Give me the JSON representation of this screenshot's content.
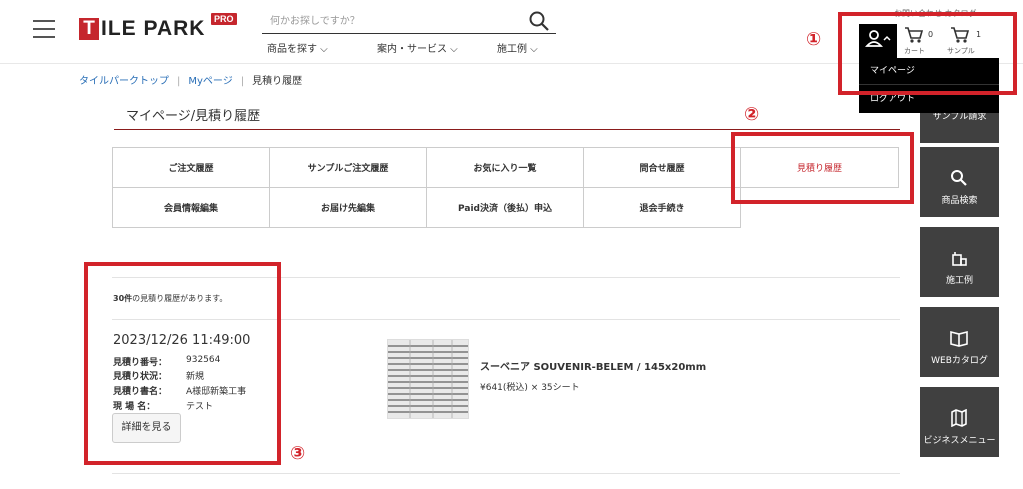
{
  "header": {
    "logo_first_letter": "T",
    "logo_rest": "ILE PARK",
    "pro_badge": "PRO",
    "search_placeholder": "何かお探しですか？",
    "nav": [
      "商品を探す ⌵",
      "案内・サービス ⌵",
      "施工例 ⌵"
    ],
    "top_link": "お問い合わせ カタログ",
    "cart_count": "0",
    "cart_label": "カート",
    "sample_count": "1",
    "sample_label": "サンプル"
  },
  "account_dropdown": {
    "mypage": "マイページ",
    "logout": "ログアウト"
  },
  "breadcrumb": {
    "home": "タイルパークトップ",
    "mypage": "Myページ",
    "current": "見積り履歴"
  },
  "page_title": "マイページ/見積り履歴",
  "menu": {
    "row1": [
      "ご注文履歴",
      "サンプルご注文履歴",
      "お気に入り一覧",
      "問合せ履歴",
      "見積り履歴"
    ],
    "row2": [
      "会員情報編集",
      "お届け先編集",
      "Paid決済（後払）申込",
      "退会手続き"
    ]
  },
  "side_panel": {
    "partial": "サンプル請求",
    "items": [
      "商品検索",
      "施工例",
      "WEBカタログ",
      "ビジネスメニュー"
    ]
  },
  "results": {
    "count": "30件",
    "count_suffix": "の見積り履歴があります。"
  },
  "entry": {
    "date": "2023/12/26 11:49:00",
    "labels": [
      "見積り番号：",
      "見積り状況：",
      "見積り書名：",
      "現 場 名："
    ],
    "values": [
      "932564",
      "新規",
      "A様邸新築工事",
      "テスト"
    ],
    "detail_button": "詳細を見る",
    "product_name": "スーベニア SOUVENIR-BELEM / 145x20mm",
    "product_price": "¥641(税込) × 35シート"
  },
  "annotations": {
    "one": "①",
    "two": "②",
    "three": "③",
    "color": "#d2232a"
  },
  "colors": {
    "brand_red": "#c5262d",
    "link_blue": "#2a6fb7",
    "side_panel_bg": "#404040"
  }
}
